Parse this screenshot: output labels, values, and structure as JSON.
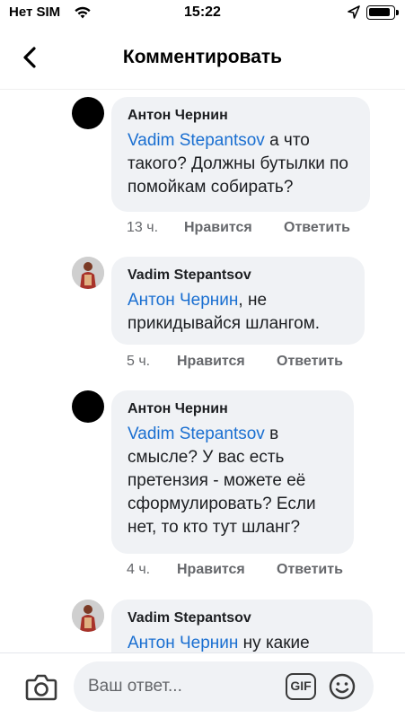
{
  "status_bar": {
    "carrier": "Нет SIM",
    "time": "15:22",
    "icons": [
      "wifi-icon",
      "location-arrow-icon",
      "battery-icon"
    ]
  },
  "header": {
    "title": "Комментировать",
    "back_icon": "chevron-left-icon"
  },
  "comments": [
    {
      "author": "Антон Чернин",
      "avatar": "black-circle",
      "mention": "Vadim Stepantsov",
      "text": " а что такого? Должны бутылки по помойкам собирать?",
      "time": "13 ч.",
      "like": "Нравится",
      "reply": "Ответить"
    },
    {
      "author": "Vadim Stepantsov",
      "avatar": "photo",
      "mention": "Антон Чернин",
      "text": ", не прикидывайся шлангом.",
      "time": "5 ч.",
      "like": "Нравится",
      "reply": "Ответить"
    },
    {
      "author": "Антон Чернин",
      "avatar": "black-circle",
      "mention": "Vadim Stepantsov",
      "text": " в смысле? У вас есть претензия - можете её сформулировать? Если нет, то кто тут шланг?",
      "time": "4 ч.",
      "like": "Нравится",
      "reply": "Ответить"
    },
    {
      "author": "Vadim Stepantsov",
      "avatar": "photo",
      "mention": "Антон Чернин",
      "text": " ну какие"
    }
  ],
  "composer": {
    "placeholder": "Ваш ответ...",
    "gif_label": "GIF",
    "icons": [
      "camera-icon",
      "gif-icon",
      "emoji-icon"
    ]
  },
  "colors": {
    "mention": "#1a6fd1",
    "bubble": "#f0f2f5",
    "meta": "#65676b"
  }
}
